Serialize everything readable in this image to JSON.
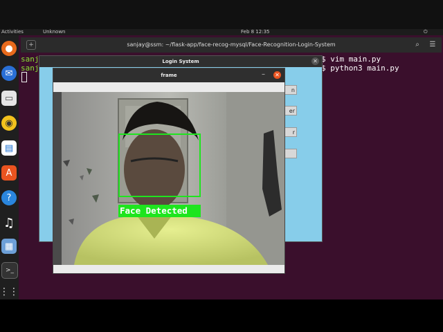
{
  "topbar": {
    "activities": "Activities",
    "app_name": "Unknown",
    "clock": "Feb 8 12:35",
    "power_icon": "power-icon"
  },
  "dock": {
    "items": [
      {
        "icon": "firefox-icon"
      },
      {
        "icon": "thunderbird-icon"
      },
      {
        "icon": "files-icon"
      },
      {
        "icon": "rhythmbox-icon"
      },
      {
        "icon": "writer-icon"
      },
      {
        "icon": "software-icon"
      },
      {
        "icon": "help-icon"
      },
      {
        "icon": "music-icon"
      },
      {
        "icon": "image-viewer-icon"
      },
      {
        "icon": "terminal-icon"
      },
      {
        "icon": "app-grid-icon"
      }
    ]
  },
  "terminal": {
    "title": "sanjay@ssm: ~/flask-app/face-recog-mysql/Face-Recognition-Login-System",
    "prompt_fragment_1": "sanj",
    "prompt_fragment_2": "sanj",
    "cmd1": "$ vim main.py",
    "cmd2": "$ python3 main.py"
  },
  "login_window": {
    "title": "Login System",
    "buttons": [
      "n",
      "er",
      "r",
      ""
    ]
  },
  "frame_window": {
    "title": "frame",
    "detection_label": "Face Detected",
    "box_color": "#1ee51e"
  },
  "colors": {
    "desktop": "#3a0f2c",
    "terminal_green": "#8ae234",
    "login_bg": "#87cdea",
    "close_orange": "#e95420"
  }
}
